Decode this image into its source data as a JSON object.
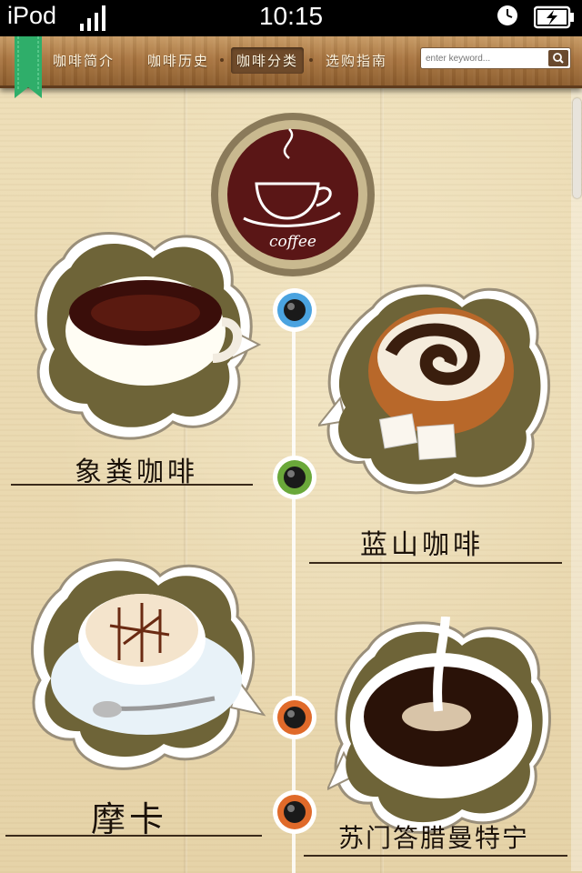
{
  "status_bar": {
    "carrier": "iPod",
    "time": "10:15",
    "signal_icon": "signal-bars-icon",
    "clock_icon": "alarm-clock-icon",
    "battery_icon": "battery-charging-icon"
  },
  "nav": {
    "items": [
      {
        "label": "咖啡简介",
        "active": false
      },
      {
        "label": "咖啡历史",
        "active": false
      },
      {
        "label": "咖啡分类",
        "active": true
      },
      {
        "label": "选购指南",
        "active": false
      }
    ],
    "search": {
      "placeholder": "enter keyword..."
    },
    "search_icon": "magnifier-icon",
    "bookmark_icon": "bookmark-ribbon-icon"
  },
  "logo": {
    "text": "coffee"
  },
  "coffees": [
    {
      "name": "象粪咖啡",
      "side": "left"
    },
    {
      "name": "蓝山咖啡",
      "side": "right"
    },
    {
      "name": "摩卡",
      "side": "left"
    },
    {
      "name": "苏门答腊曼特宁",
      "side": "right"
    }
  ],
  "colors": {
    "wood": "#a97540",
    "paper": "#eedfb9",
    "dot_blue": "#4aa3e0",
    "dot_green": "#6aa83a",
    "dot_orange": "#e06a2a",
    "logo_bg": "#5a1616"
  }
}
